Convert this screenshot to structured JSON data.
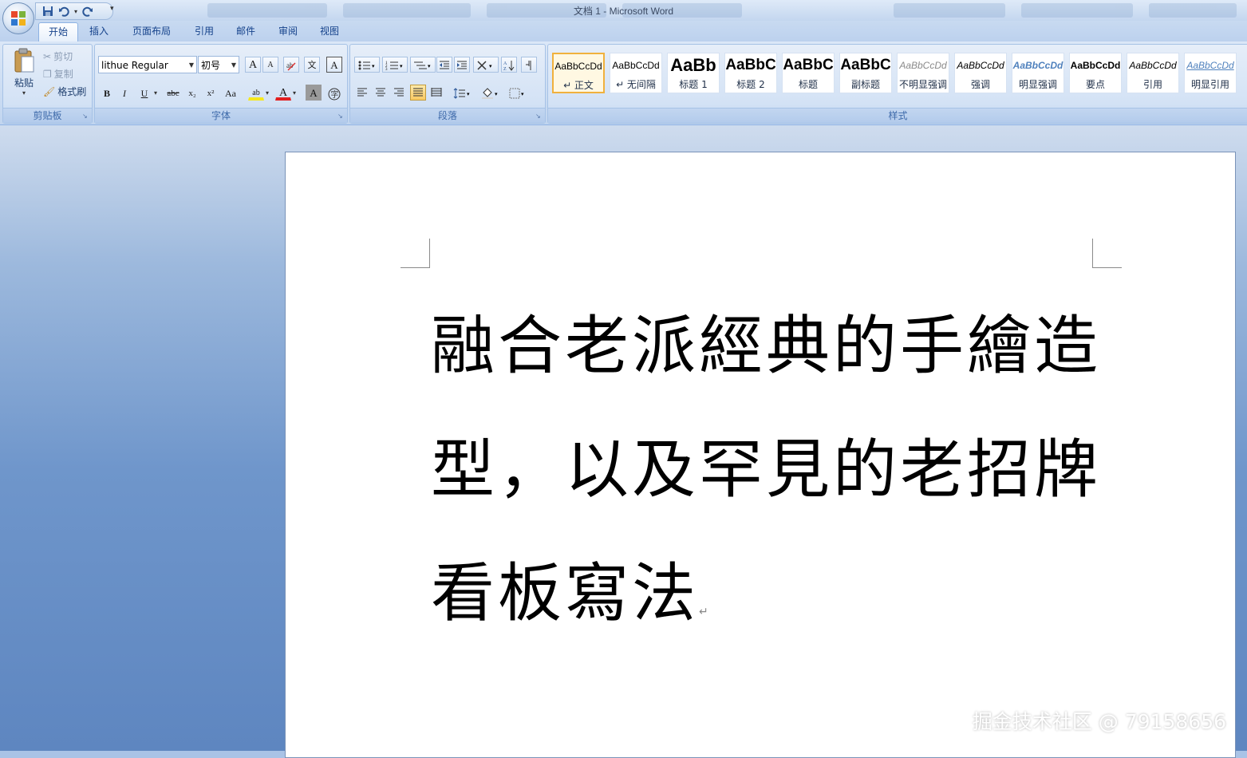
{
  "window": {
    "title": "文档 1 - Microsoft Word"
  },
  "ribbon_tabs": [
    {
      "label": "开始"
    },
    {
      "label": "插入"
    },
    {
      "label": "页面布局"
    },
    {
      "label": "引用"
    },
    {
      "label": "邮件"
    },
    {
      "label": "审阅"
    },
    {
      "label": "视图"
    }
  ],
  "clipboard": {
    "paste": "粘贴",
    "cut": "剪切",
    "copy": "复制",
    "format_painter": "格式刷",
    "label": "剪贴板"
  },
  "font": {
    "name": "lithue Regular",
    "size": "初号",
    "label": "字体",
    "grow": "A",
    "shrink": "A",
    "bold": "B",
    "italic": "I",
    "underline": "U",
    "strike": "abc",
    "subscript": "x₂",
    "superscript": "x²",
    "case": "Aa",
    "highlight": "ab",
    "font_color": "A",
    "char_shading": "A"
  },
  "paragraph": {
    "label": "段落"
  },
  "styles": {
    "label": "样式",
    "items": [
      {
        "sample": "AaBbCcDd",
        "name": "↵ 正文"
      },
      {
        "sample": "AaBbCcDd",
        "name": "↵ 无间隔"
      },
      {
        "sample": "AaBb",
        "name": "标题 1"
      },
      {
        "sample": "AaBbC",
        "name": "标题 2"
      },
      {
        "sample": "AaBbC",
        "name": "标题"
      },
      {
        "sample": "AaBbC",
        "name": "副标题"
      },
      {
        "sample": "AaBbCcDd",
        "name": "不明显强调"
      },
      {
        "sample": "AaBbCcDd",
        "name": "强调"
      },
      {
        "sample": "AaBbCcDd",
        "name": "明显强调"
      },
      {
        "sample": "AaBbCcDd",
        "name": "要点"
      },
      {
        "sample": "AaBbCcDd",
        "name": "引用"
      },
      {
        "sample": "AaBbCcDd",
        "name": "明显引用"
      }
    ]
  },
  "document": {
    "text": "融合老派經典的手繪造型，以及罕見的老招牌看板寫法",
    "paragraph_mark": "↵"
  },
  "watermark": "掘金技术社区 @ 79158656",
  "colors": {
    "highlight": "#f6e81c",
    "font_color": "#e21f1f",
    "selected_style_border": "#f0b13d"
  }
}
